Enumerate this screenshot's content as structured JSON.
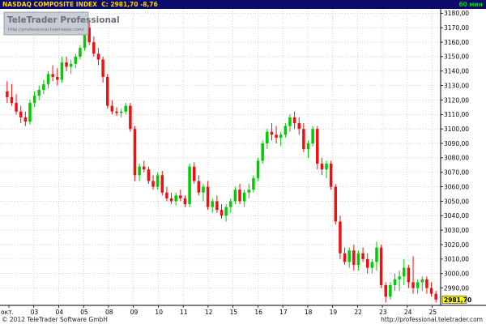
{
  "header": {
    "instrument": "NASDAQ COMPOSITE INDEX",
    "quote": "C: 2981,70  -8,76",
    "interval": "60 мин"
  },
  "watermark": {
    "brand": "TeleTrader Professional",
    "url": "http://professional.teletrader.com/"
  },
  "footer": {
    "copyright": "© 2012 TeleTrader Software GmbH",
    "url": "http://professional.teletrader.com"
  },
  "colors": {
    "up": "#00cc00",
    "down": "#ee1111",
    "grid": "#b8b8b8",
    "header_bg": "#0b0b6e",
    "last_price_bg": "#ffff00"
  },
  "chart_data": {
    "type": "candlestick",
    "title": "NASDAQ COMPOSITE INDEX",
    "last_price": 2981.7,
    "last_price_label": "2981,70",
    "y_ticks": [
      "3180,00",
      "3170,00",
      "3160,00",
      "3150,00",
      "3140,00",
      "3130,00",
      "3120,00",
      "3110,00",
      "3100,00",
      "3090,00",
      "3080,00",
      "3070,00",
      "3060,00",
      "3050,00",
      "3040,00",
      "3030,00",
      "3020,00",
      "3010,00",
      "3000,00",
      "2990,00"
    ],
    "ylim": [
      2978,
      3183
    ],
    "x_labels": [
      "окт.",
      "03",
      "04",
      "05",
      "08",
      "09",
      "10",
      "11",
      "12",
      "15",
      "16",
      "17",
      "18",
      "19",
      "22",
      "23",
      "24",
      "25"
    ],
    "grid": true,
    "ohlc": [
      [
        3126,
        3133,
        3118,
        3122
      ],
      [
        3122,
        3131,
        3116,
        3118
      ],
      [
        3118,
        3124,
        3110,
        3112
      ],
      [
        3112,
        3116,
        3104,
        3108
      ],
      [
        3108,
        3112,
        3102,
        3105
      ],
      [
        3105,
        3120,
        3103,
        3118
      ],
      [
        3118,
        3126,
        3115,
        3123
      ],
      [
        3123,
        3130,
        3120,
        3127
      ],
      [
        3127,
        3134,
        3124,
        3131
      ],
      [
        3131,
        3140,
        3128,
        3138
      ],
      [
        3138,
        3144,
        3133,
        3136
      ],
      [
        3136,
        3142,
        3130,
        3134
      ],
      [
        3134,
        3150,
        3132,
        3146
      ],
      [
        3146,
        3150,
        3140,
        3143
      ],
      [
        3143,
        3148,
        3138,
        3145
      ],
      [
        3145,
        3152,
        3142,
        3150
      ],
      [
        3150,
        3158,
        3148,
        3156
      ],
      [
        3156,
        3172,
        3154,
        3170
      ],
      [
        3170,
        3174,
        3158,
        3160
      ],
      [
        3160,
        3164,
        3150,
        3152
      ],
      [
        3152,
        3156,
        3144,
        3148
      ],
      [
        3148,
        3150,
        3132,
        3136
      ],
      [
        3136,
        3138,
        3114,
        3116
      ],
      [
        3116,
        3120,
        3110,
        3112
      ],
      [
        3112,
        3115,
        3109,
        3111
      ],
      [
        3111,
        3114,
        3108,
        3112
      ],
      [
        3112,
        3118,
        3110,
        3116
      ],
      [
        3116,
        3118,
        3098,
        3100
      ],
      [
        3100,
        3102,
        3064,
        3068
      ],
      [
        3068,
        3076,
        3064,
        3074
      ],
      [
        3074,
        3078,
        3070,
        3072
      ],
      [
        3072,
        3074,
        3062,
        3064
      ],
      [
        3064,
        3068,
        3058,
        3060
      ],
      [
        3060,
        3070,
        3058,
        3068
      ],
      [
        3068,
        3071,
        3054,
        3056
      ],
      [
        3056,
        3060,
        3050,
        3052
      ],
      [
        3052,
        3056,
        3048,
        3050
      ],
      [
        3050,
        3056,
        3047,
        3054
      ],
      [
        3054,
        3058,
        3050,
        3052
      ],
      [
        3052,
        3054,
        3046,
        3048
      ],
      [
        3048,
        3076,
        3046,
        3074
      ],
      [
        3074,
        3077,
        3062,
        3064
      ],
      [
        3064,
        3068,
        3054,
        3056
      ],
      [
        3056,
        3062,
        3050,
        3060
      ],
      [
        3060,
        3064,
        3044,
        3046
      ],
      [
        3046,
        3052,
        3042,
        3050
      ],
      [
        3050,
        3054,
        3042,
        3044
      ],
      [
        3044,
        3048,
        3038,
        3040
      ],
      [
        3040,
        3048,
        3036,
        3046
      ],
      [
        3046,
        3052,
        3042,
        3050
      ],
      [
        3050,
        3060,
        3048,
        3058
      ],
      [
        3058,
        3062,
        3048,
        3050
      ],
      [
        3050,
        3058,
        3046,
        3056
      ],
      [
        3056,
        3062,
        3052,
        3058
      ],
      [
        3058,
        3068,
        3056,
        3066
      ],
      [
        3066,
        3080,
        3064,
        3078
      ],
      [
        3078,
        3092,
        3076,
        3090
      ],
      [
        3090,
        3100,
        3086,
        3098
      ],
      [
        3098,
        3104,
        3092,
        3096
      ],
      [
        3096,
        3102,
        3090,
        3094
      ],
      [
        3094,
        3098,
        3088,
        3096
      ],
      [
        3096,
        3104,
        3094,
        3102
      ],
      [
        3102,
        3110,
        3098,
        3108
      ],
      [
        3108,
        3112,
        3100,
        3104
      ],
      [
        3104,
        3108,
        3096,
        3100
      ],
      [
        3100,
        3104,
        3084,
        3086
      ],
      [
        3086,
        3092,
        3080,
        3090
      ],
      [
        3090,
        3102,
        3088,
        3100
      ],
      [
        3100,
        3102,
        3072,
        3076
      ],
      [
        3076,
        3080,
        3068,
        3072
      ],
      [
        3072,
        3078,
        3066,
        3076
      ],
      [
        3076,
        3078,
        3058,
        3060
      ],
      [
        3060,
        3062,
        3034,
        3036
      ],
      [
        3036,
        3040,
        3010,
        3014
      ],
      [
        3014,
        3018,
        3006,
        3008
      ],
      [
        3008,
        3018,
        3004,
        3016
      ],
      [
        3016,
        3020,
        3002,
        3006
      ],
      [
        3006,
        3016,
        3002,
        3014
      ],
      [
        3014,
        3018,
        3008,
        3010
      ],
      [
        3010,
        3014,
        3000,
        3004
      ],
      [
        3004,
        3010,
        3000,
        3008
      ],
      [
        3008,
        3022,
        3002,
        3018
      ],
      [
        3018,
        3020,
        2990,
        2992
      ],
      [
        2992,
        2994,
        2980,
        2984
      ],
      [
        2984,
        2994,
        2982,
        2992
      ],
      [
        2992,
        3000,
        2988,
        2996
      ],
      [
        2996,
        3002,
        2988,
        2998
      ],
      [
        2998,
        3010,
        2992,
        3004
      ],
      [
        3004,
        3006,
        2990,
        2994
      ],
      [
        2994,
        3012,
        2986,
        2990
      ],
      [
        2990,
        2996,
        2986,
        2994
      ],
      [
        2994,
        2998,
        2988,
        2996
      ],
      [
        2996,
        2998,
        2986,
        2990
      ],
      [
        2990,
        2994,
        2984,
        2986
      ],
      [
        2986,
        2988,
        2980,
        2982
      ]
    ]
  }
}
